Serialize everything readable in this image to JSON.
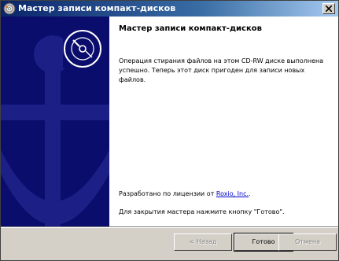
{
  "window": {
    "title": "Мастер записи компакт-дисков"
  },
  "wizard": {
    "heading": "Мастер записи компакт-дисков",
    "description": "Операция стирания файлов на этом CD-RW диске выполнена успешно. Теперь этот диск пригоден для записи новых файлов.",
    "credit_prefix": "Разработано по лицензии от ",
    "credit_link": "Roxio, Inc.",
    "credit_suffix": ".",
    "finish_hint": "Для закрытия мастера нажмите кнопку \"Готово\"."
  },
  "buttons": {
    "back_label": "< Назад",
    "finish_label": "Готово",
    "cancel_label": "Отмена"
  },
  "icons": {
    "title_icon": "cd-burn-icon",
    "close_icon": "close-icon",
    "disc_icon": "cd-disc-icon"
  },
  "colors": {
    "side_panel": "#0b0d6c",
    "titlebar_start": "#0a246a",
    "titlebar_end": "#a6caf0"
  }
}
